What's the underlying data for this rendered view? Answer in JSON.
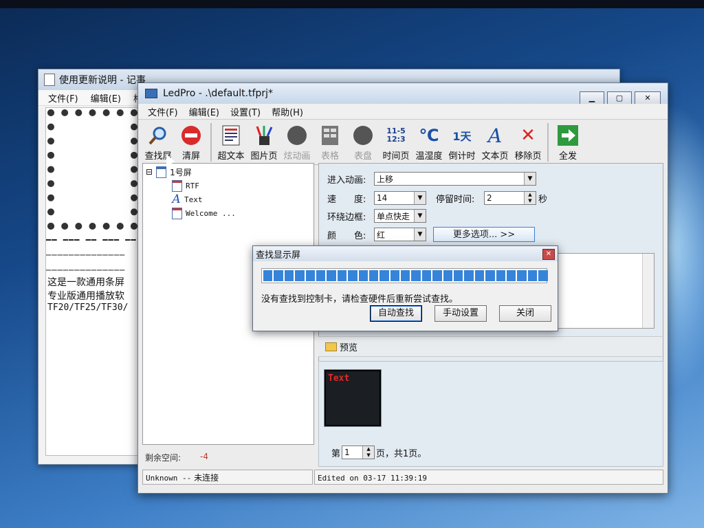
{
  "notepad": {
    "title": "使用更新说明 - 记事",
    "menu": [
      "文件(F)",
      "编辑(E)",
      "格"
    ],
    "dashes": [
      "━━ ━━━ ━━ ━━━ ━━",
      "──────────────",
      "──────────────"
    ],
    "lines": [
      "这是一款通用条屏",
      "专业版通用播放软",
      "TF20/TF25/TF30/"
    ]
  },
  "window": {
    "title": "LedPro - .\\default.tfprj*",
    "controls": {
      "minimize": "▁",
      "maximize": "▢",
      "close": "✕"
    }
  },
  "menu": [
    "文件(F)",
    "编辑(E)",
    "设置(T)",
    "帮助(H)"
  ],
  "toolbar": {
    "find": "查找屏",
    "clear": "清屏",
    "rich_text": "超文本",
    "image_page": "图片页",
    "animation": "炫动画",
    "table": "表格",
    "dial": "表盘",
    "time_page": "时间页",
    "time_icon_top": "11-5",
    "time_icon_bottom": "12:3",
    "temp_humidity": "温湿度",
    "temp_icon": "℃",
    "countdown": "倒计时",
    "countdown_icon": "1天",
    "text_page": "文本页",
    "text_icon": "A",
    "remove_page": "移除页",
    "remove_icon": "✕",
    "send_all": "全发"
  },
  "tree": {
    "expand": "⊟",
    "root": "1号屏",
    "items": [
      "RTF",
      "Text",
      "Welcome ..."
    ]
  },
  "remaining": {
    "label": "剩余空间:",
    "value": "-4"
  },
  "properties": {
    "enter_anim_label": "进入动画:",
    "enter_anim_value": "上移",
    "speed_label": "速　　度:",
    "speed_value": "14",
    "stay_label": "停留时间:",
    "stay_value": "2",
    "stay_unit": "秒",
    "border_label": "环绕边框:",
    "border_value": "单点快走",
    "color_label": "颜　　色:",
    "color_value": "红",
    "more_options": "更多选项...  >>"
  },
  "preview": {
    "label": "预览",
    "led_text": "Text",
    "pager_prefix": "第",
    "page_value": "1",
    "pager_suffix": "页，共1页。"
  },
  "status": {
    "left_code": "Unknown --",
    "left_text": "未连接",
    "right": "Edited on 03-17 11:39:19"
  },
  "dialog": {
    "title": "查找显示屏",
    "close": "✕",
    "message": "没有查找到控制卡，请检查硬件后重新尝试查找。",
    "auto_find": "自动查找",
    "manual_setup": "手动设置",
    "close_button": "关闭"
  },
  "progress": 1.0,
  "colors": {
    "accent": "#3584d9",
    "led_text": "#e02a2a",
    "warning_value": "#c0392b"
  }
}
